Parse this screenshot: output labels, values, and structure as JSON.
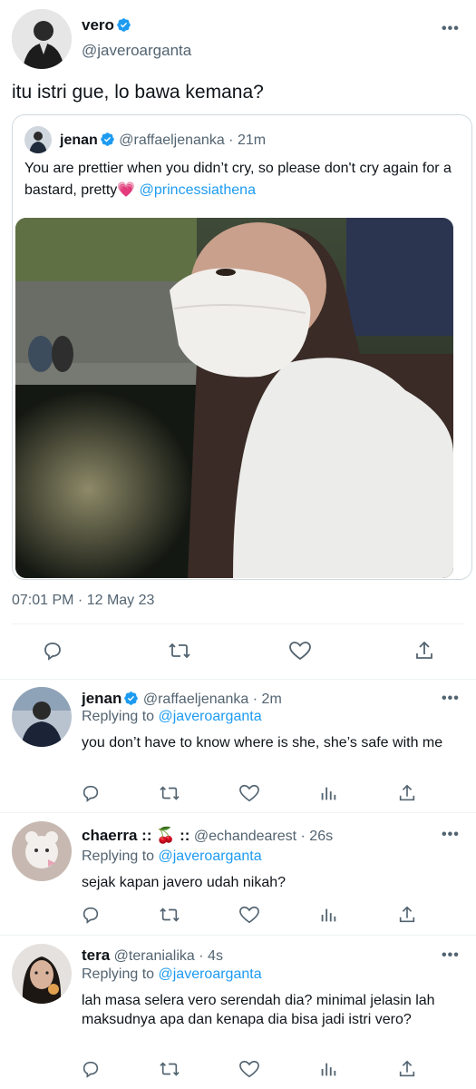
{
  "main_tweet": {
    "name": "vero",
    "handle": "@javeroarganta",
    "text": "itu istri gue, lo bawa kemana?",
    "timestamp": "07:01 PM · 12 May 23"
  },
  "quoted_tweet": {
    "name": "jenan",
    "handle": "@raffaeljenanka",
    "time": "· 21m",
    "text": "You are prettier when you didn’t cry, so please don't cry again for a bastard, pretty💗",
    "mention": "@princessiathena"
  },
  "replies": [
    {
      "name": "jenan",
      "handle": "@raffaeljenanka",
      "time": "· 2m",
      "replying_prefix": "Replying to",
      "replying_to": "@javeroarganta",
      "text": "you don’t have to know where is she, she’s safe with me"
    },
    {
      "name": "chaerra :: 🍒 ::",
      "handle": "@echandearest",
      "time": "· 26s",
      "replying_prefix": "Replying to",
      "replying_to": "@javeroarganta",
      "text": "sejak kapan javero udah nikah?"
    },
    {
      "name": "tera",
      "handle": "@teranialika",
      "time": "· 4s",
      "replying_prefix": "Replying to",
      "replying_to": "@javeroarganta",
      "text": "lah masa selera vero serendah dia? minimal jelasin lah maksudnya apa dan kenapa dia bisa jadi istri vero?"
    }
  ],
  "more_icon_glyph": "•••",
  "colors": {
    "link": "#1d9bf0",
    "muted": "#536471",
    "divider": "#eff3f4"
  }
}
